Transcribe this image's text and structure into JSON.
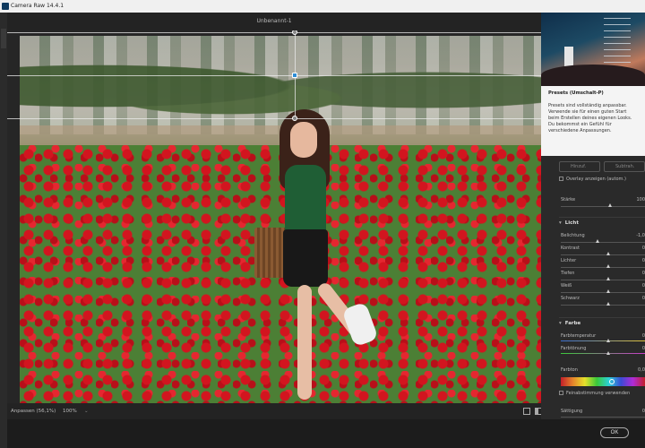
{
  "window": {
    "title": "Camera Raw 14.4.1"
  },
  "document": {
    "title": "Unbenannt-1"
  },
  "status": {
    "zoom_fit": "Anpassen (56,1%)",
    "zoom_100": "100%",
    "caret": "⌄"
  },
  "footer": {
    "ok_label": "OK"
  },
  "panel": {
    "tooltip": {
      "heading": "Presets (Umschalt-P)",
      "body": "Presets sind vollständig anpassbar. Verwende sie für einen guten Start beim Erstellen deines eigenen Looks. Du bekommst ein Gefühl für verschiedene Anpassungen."
    },
    "buttons": {
      "a": "Hinzuf.",
      "b": "Subtrah."
    },
    "overlay_checkbox": "Overlay anzeigen (autom.)",
    "staerke": {
      "label": "Stärke",
      "value": "100"
    },
    "licht": {
      "title": "Licht",
      "rows": [
        {
          "label": "Belichtung",
          "value": "-1,0"
        },
        {
          "label": "Kontrast",
          "value": "0"
        },
        {
          "label": "Lichter",
          "value": "0"
        },
        {
          "label": "Tiefen",
          "value": "0"
        },
        {
          "label": "Weiß",
          "value": "0"
        },
        {
          "label": "Schwarz",
          "value": "0"
        }
      ]
    },
    "farbe": {
      "title": "Farbe",
      "rows": [
        {
          "label": "Farbtemperatur",
          "value": "0"
        },
        {
          "label": "Farbtönung",
          "value": "0"
        }
      ],
      "farbton": {
        "label": "Farbton",
        "value": "0,0"
      },
      "feinabstimmung": "Feinabstimmung verwenden",
      "saettigung": {
        "label": "Sättigung",
        "value": "0"
      }
    }
  },
  "colors": {
    "accent": "#2f8dd6",
    "panel_bg": "#2a2a2a",
    "canvas_bg": "#262626"
  }
}
